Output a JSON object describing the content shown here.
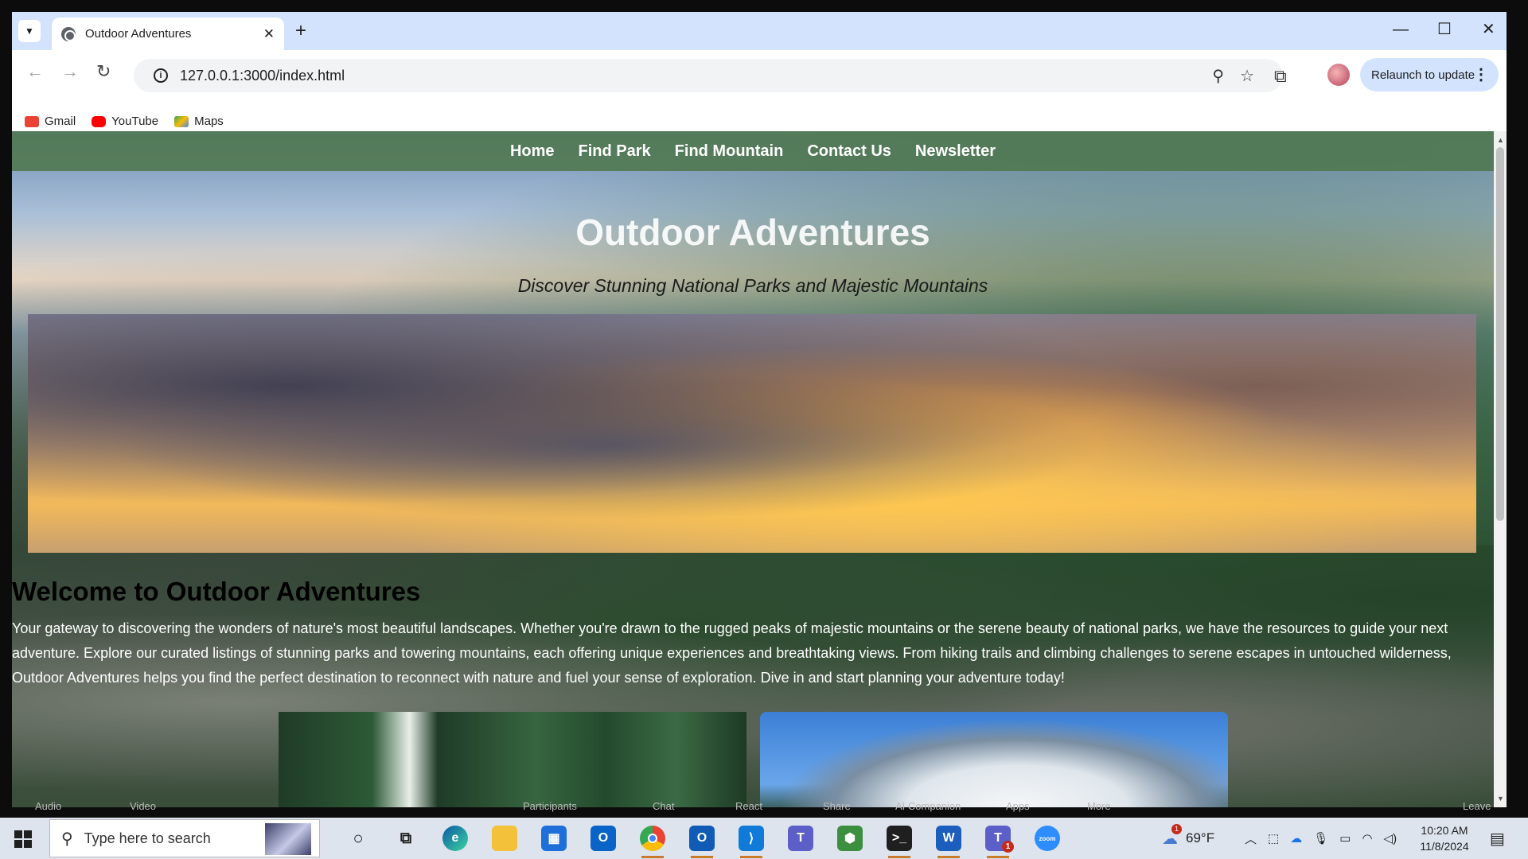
{
  "browser": {
    "tab_title": "Outdoor Adventures",
    "tab_close": "✕",
    "new_tab": "+",
    "url": "127.0.0.1:3000/index.html",
    "relaunch_label": "Relaunch to update",
    "bookmarks": [
      {
        "label": "Gmail",
        "color": "#ea4335"
      },
      {
        "label": "YouTube",
        "color": "#ff0000"
      },
      {
        "label": "Maps",
        "color": "#34a853"
      }
    ]
  },
  "site": {
    "nav": [
      "Home",
      "Find Park",
      "Find Mountain",
      "Contact Us",
      "Newsletter"
    ],
    "hero_title": "Outdoor Adventures",
    "hero_subtitle": "Discover Stunning National Parks and Majestic Mountains",
    "welcome_heading": "Welcome to Outdoor Adventures",
    "welcome_text": "Your gateway to discovering the wonders of nature's most beautiful landscapes. Whether you're drawn to the rugged peaks of majestic mountains or the serene beauty of national parks, we have the resources to guide your next adventure. Explore our curated listings of stunning parks and towering mountains, each offering unique experiences and breathtaking views. From hiking trails and climbing challenges to serene escapes in untouched wilderness, Outdoor Adventures helps you find the perfect destination to reconnect with nature and fuel your sense of exploration. Dive in and start planning your adventure today!"
  },
  "zoom_controls": [
    "Audio",
    "Video",
    "Participants",
    "Chat",
    "React",
    "Share",
    "AI Companion",
    "Apps",
    "More",
    "Leave"
  ],
  "taskbar": {
    "search_placeholder": "Type here to search",
    "weather": "69°F",
    "weather_badge": "1",
    "teams_badge": "1",
    "time": "10:20 AM",
    "date": "11/8/2024"
  }
}
